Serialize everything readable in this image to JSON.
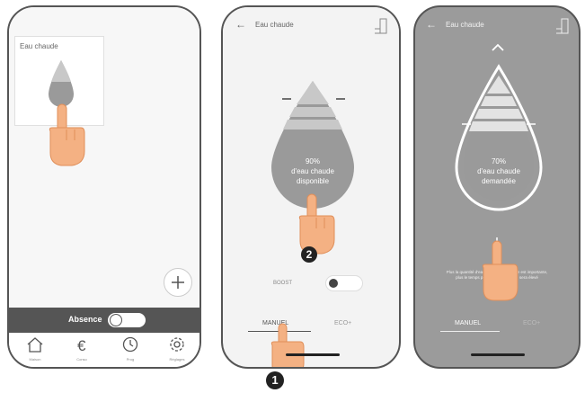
{
  "screen1": {
    "widget_title": "Eau chaude",
    "absence_label": "Absence",
    "nav": [
      {
        "label": "Maison",
        "icon": "home-icon"
      },
      {
        "label": "Conso",
        "icon": "euro-icon"
      },
      {
        "label": "Prog",
        "icon": "clock-icon"
      },
      {
        "label": "Réglages",
        "icon": "gear-icon"
      }
    ]
  },
  "screen2": {
    "title": "Eau chaude",
    "drop_percent": "90%",
    "drop_line1": "d'eau chaude",
    "drop_line2": "disponible",
    "boost_label": "BOOST",
    "tab_manual": "MANUEL",
    "tab_eco": "ECO+"
  },
  "screen3": {
    "title": "Eau chaude",
    "drop_percent": "70%",
    "drop_line1": "d'eau chaude",
    "drop_line2": "demandée",
    "info_line1": "Plus la quantité d'eau chaude demandée est importante,",
    "info_line2": "plus le temps pour de l'eau chaude sera élevé",
    "tab_manual": "MANUEL",
    "tab_eco": "ECO+"
  },
  "steps": {
    "step1": "1",
    "step2": "2"
  },
  "colors": {
    "drop": "#9a9a9a",
    "hand": "#f4b183",
    "accent": "#222222"
  }
}
